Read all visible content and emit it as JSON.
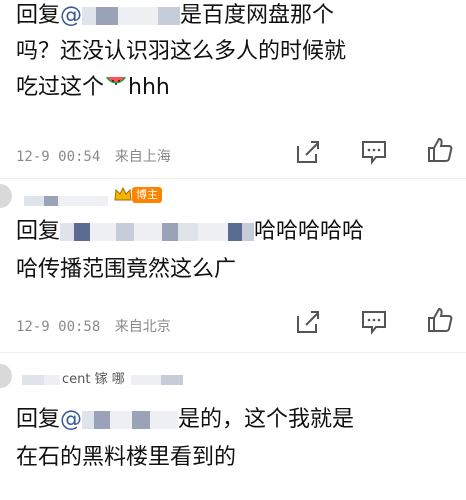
{
  "comments": [
    {
      "reply_prefix": "回复",
      "mention_at": "@",
      "line1_tail": "是百度网盘那个",
      "line2": "吗？还没认识羽这么多人的时候就",
      "line3_text": "吃过这个",
      "line3_tail": "hhh",
      "timestamp": "12-9 00:54",
      "location": "来自上海"
    },
    {
      "user_badge": "博主",
      "reply_prefix": "回复",
      "line1_tail": "哈哈哈哈哈",
      "line2": "哈传播范围竟然这么广",
      "timestamp": "12-9 00:58",
      "location": "来自北京"
    },
    {
      "username_partial": "cent 镓 哪",
      "reply_prefix": "回复",
      "mention_at": "@",
      "line1_tail": "是的，这个我就是",
      "line2": "在石的黑料楼里看到的"
    }
  ],
  "icons": [
    "share-icon",
    "comment-icon",
    "like-icon",
    "watermelon-icon",
    "crown-icon"
  ],
  "colors": {
    "badge": "#ff8200",
    "mention": "#3b5998",
    "meta": "#8a8a8a"
  }
}
